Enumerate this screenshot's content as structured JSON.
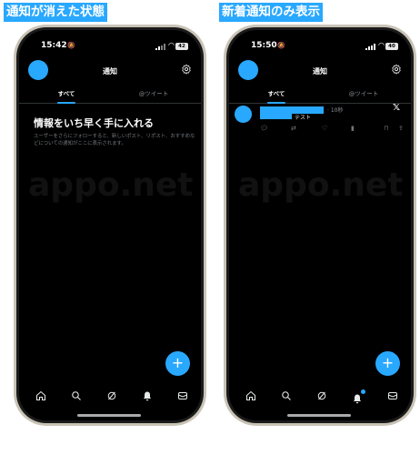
{
  "left": {
    "caption": "通知が消えた状態",
    "status": {
      "time": "15:42",
      "battery": "42"
    },
    "header": {
      "title": "通知"
    },
    "tabs": [
      {
        "label": "すべて"
      },
      {
        "label": "@ツイート"
      }
    ],
    "empty": {
      "title": "情報をいち早く手に入れる",
      "body": "ユーザーをさらにフォローすると、新しいポスト、リポスト、おすすめなどについての通知がここに表示されます。"
    },
    "watermark": "appo.net"
  },
  "right": {
    "caption": "新着通知のみ表示",
    "status": {
      "time": "15:50",
      "battery": "40"
    },
    "header": {
      "title": "通知"
    },
    "tabs": [
      {
        "label": "すべて"
      },
      {
        "label": "@ツイート"
      }
    ],
    "notification": {
      "time": "· 10秒",
      "text": "テスト",
      "source": "𝕏"
    },
    "watermark": "appo.net"
  },
  "fab_label": "+",
  "colors": {
    "accent": "#29a8ff",
    "background": "#000000"
  },
  "icons": [
    "home-icon",
    "search-icon",
    "grok-icon",
    "bell-icon",
    "mail-icon",
    "gear-icon"
  ]
}
